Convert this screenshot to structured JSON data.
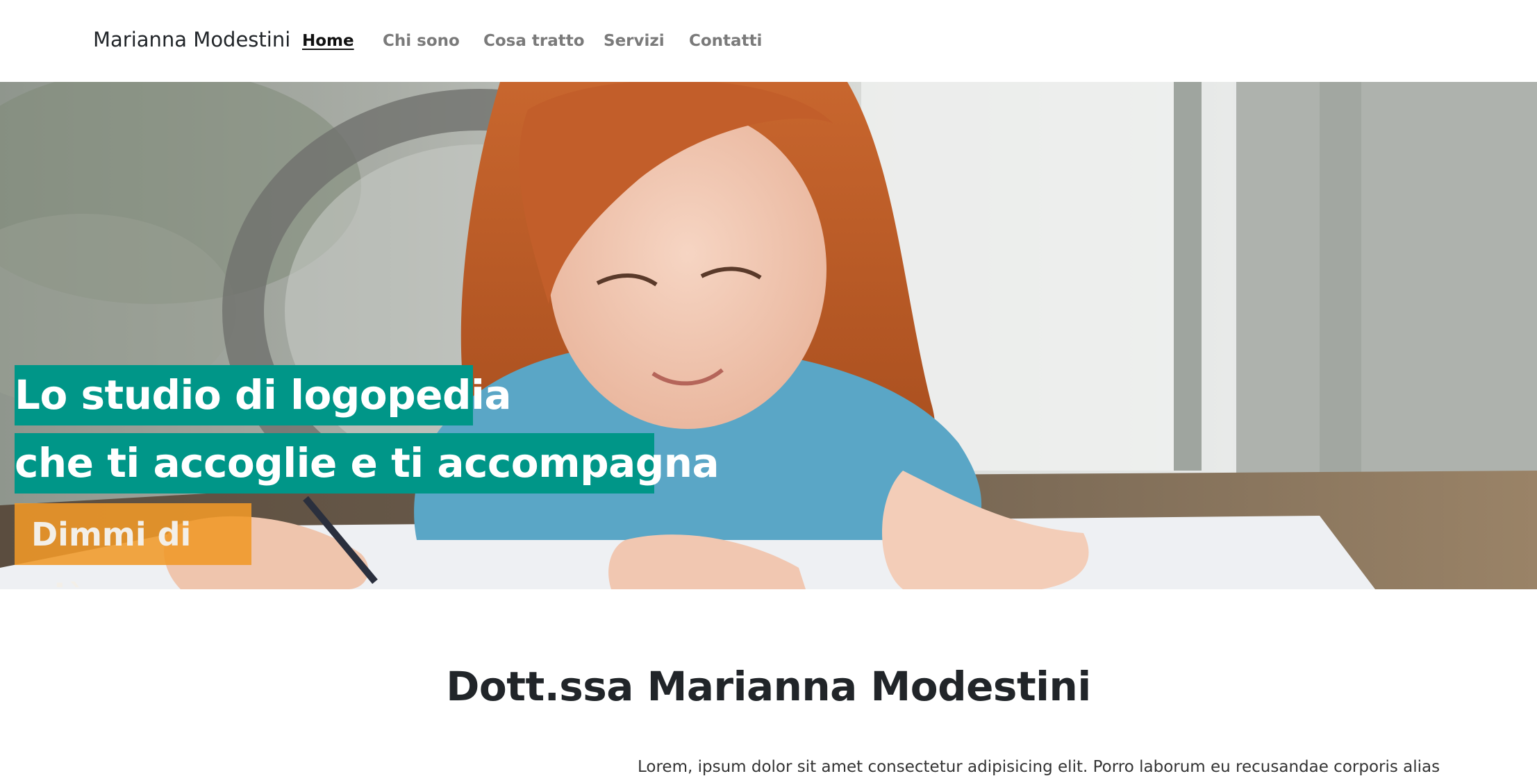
{
  "navbar": {
    "brand": "Marianna Modestini",
    "links": [
      {
        "label": "Home",
        "active": true
      },
      {
        "label": "Chi sono",
        "active": false
      },
      {
        "label": "Cosa tratto",
        "active": false
      },
      {
        "label": "Servizi",
        "active": false
      },
      {
        "label": "Contatti",
        "active": false
      }
    ]
  },
  "hero": {
    "line1": "Lo studio di logopedia",
    "line2": "che ti accoglie e ti accompagna",
    "cta_label": "Dimmi di più",
    "image_icon": "hero-photo-child-drawing"
  },
  "main": {
    "title": "Dott.ssa Marianna Modestini",
    "intro": "Lorem, ipsum dolor sit amet consectetur adipisicing elit. Porro laborum eu recusandae corporis alias"
  },
  "colors": {
    "accent_teal": "#009688",
    "cta_orange": "#F09828",
    "text_dark": "#212529",
    "nav_muted": "#7A7A7A"
  }
}
